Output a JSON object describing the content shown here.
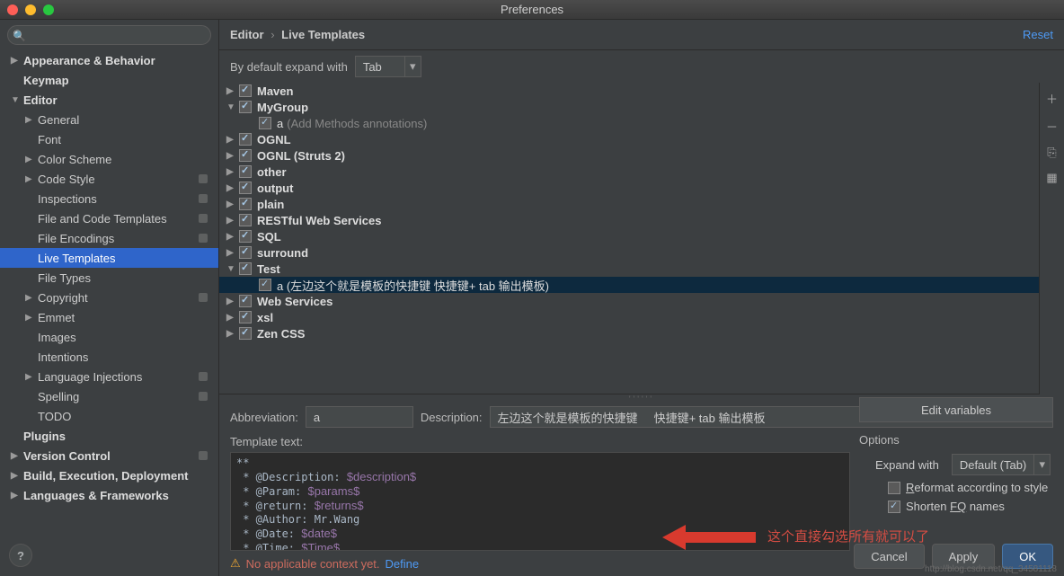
{
  "window": {
    "title": "Preferences"
  },
  "sidebar": {
    "search_placeholder": "",
    "items": [
      {
        "label": "Appearance & Behavior",
        "bold": true,
        "arrow": "▶",
        "level": 0
      },
      {
        "label": "Keymap",
        "bold": true,
        "arrow": "",
        "level": 0
      },
      {
        "label": "Editor",
        "bold": true,
        "arrow": "▼",
        "level": 0
      },
      {
        "label": "General",
        "arrow": "▶",
        "level": 1
      },
      {
        "label": "Font",
        "arrow": "",
        "level": 1
      },
      {
        "label": "Color Scheme",
        "arrow": "▶",
        "level": 1
      },
      {
        "label": "Code Style",
        "arrow": "▶",
        "level": 1,
        "badge": true
      },
      {
        "label": "Inspections",
        "arrow": "",
        "level": 1,
        "badge": true
      },
      {
        "label": "File and Code Templates",
        "arrow": "",
        "level": 1,
        "badge": true
      },
      {
        "label": "File Encodings",
        "arrow": "",
        "level": 1,
        "badge": true
      },
      {
        "label": "Live Templates",
        "arrow": "",
        "level": 1,
        "selected": true
      },
      {
        "label": "File Types",
        "arrow": "",
        "level": 1
      },
      {
        "label": "Copyright",
        "arrow": "▶",
        "level": 1,
        "badge": true
      },
      {
        "label": "Emmet",
        "arrow": "▶",
        "level": 1
      },
      {
        "label": "Images",
        "arrow": "",
        "level": 1
      },
      {
        "label": "Intentions",
        "arrow": "",
        "level": 1
      },
      {
        "label": "Language Injections",
        "arrow": "▶",
        "level": 1,
        "badge": true
      },
      {
        "label": "Spelling",
        "arrow": "",
        "level": 1,
        "badge": true
      },
      {
        "label": "TODO",
        "arrow": "",
        "level": 1
      },
      {
        "label": "Plugins",
        "bold": true,
        "arrow": "",
        "level": 0
      },
      {
        "label": "Version Control",
        "bold": true,
        "arrow": "▶",
        "level": 0,
        "badge": true
      },
      {
        "label": "Build, Execution, Deployment",
        "bold": true,
        "arrow": "▶",
        "level": 0
      },
      {
        "label": "Languages & Frameworks",
        "bold": true,
        "arrow": "▶",
        "level": 0
      }
    ]
  },
  "breadcrumb": {
    "a": "Editor",
    "sep": "›",
    "b": "Live Templates"
  },
  "reset_label": "Reset",
  "expand": {
    "label": "By default expand with",
    "value": "Tab"
  },
  "template_groups": [
    {
      "arrow": "▶",
      "label": "Maven"
    },
    {
      "arrow": "▼",
      "label": "MyGroup",
      "children": [
        {
          "label": "a",
          "desc": "(Add Methods annotations)"
        }
      ]
    },
    {
      "arrow": "▶",
      "label": "OGNL"
    },
    {
      "arrow": "▶",
      "label": "OGNL (Struts 2)"
    },
    {
      "arrow": "▶",
      "label": "other"
    },
    {
      "arrow": "▶",
      "label": "output"
    },
    {
      "arrow": "▶",
      "label": "plain"
    },
    {
      "arrow": "▶",
      "label": "RESTful Web Services"
    },
    {
      "arrow": "▶",
      "label": "SQL"
    },
    {
      "arrow": "▶",
      "label": "surround"
    },
    {
      "arrow": "▼",
      "label": "Test",
      "children": [
        {
          "label": "a (左边这个就是模板的快捷键     快捷键+ tab 输出模板)",
          "selected": true
        }
      ]
    },
    {
      "arrow": "▶",
      "label": "Web Services"
    },
    {
      "arrow": "▶",
      "label": "xsl"
    },
    {
      "arrow": "▶",
      "label": "Zen CSS"
    }
  ],
  "tools": {
    "add": "＋",
    "remove": "－",
    "copy_icon": "⎘",
    "settings_icon": "▦"
  },
  "form": {
    "abbr_label": "Abbreviation:",
    "abbr_value": "a",
    "desc_label": "Description:",
    "desc_value": "左边这个就是模板的快捷键     快捷键+ tab 输出模板",
    "template_text_label": "Template text:"
  },
  "template_text_lines": [
    "**",
    " * @Description: $description$",
    " * @Param: $params$",
    " * @return: $returns$",
    " * @Author: Mr.Wang",
    " * @Date: $date$",
    " * @Time: $Time$"
  ],
  "edit_vars_label": "Edit variables",
  "options": {
    "title": "Options",
    "expand_label": "Expand with",
    "expand_value": "Default (Tab)",
    "reformat": "Reformat according to style",
    "shorten": "Shorten FQ names",
    "r_underline": "R",
    "fq_underline": "FQ"
  },
  "context": {
    "warn": "⚠",
    "text": "No applicable context yet.",
    "define": "Define"
  },
  "annotation_text": "这个直接勾选所有就可以了",
  "buttons": {
    "cancel": "Cancel",
    "apply": "Apply",
    "ok": "OK"
  },
  "watermark": "http://blog.csdn.net/qq_34581118",
  "help": "?"
}
